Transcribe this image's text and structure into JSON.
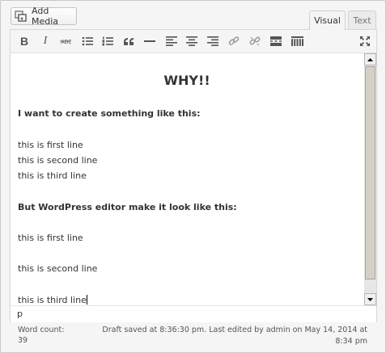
{
  "media": {
    "add_media_label": "Add Media"
  },
  "tabs": {
    "visual": "Visual",
    "text": "Text"
  },
  "toolbar": {
    "icons": [
      "bold-icon",
      "italic-icon",
      "strikethrough-icon",
      "bulleted-list-icon",
      "numbered-list-icon",
      "blockquote-icon",
      "horizontal-line-icon",
      "align-left-icon",
      "align-center-icon",
      "align-right-icon",
      "insert-link-icon",
      "remove-link-icon",
      "read-more-icon",
      "toolbar-toggle-icon",
      "fullscreen-icon"
    ]
  },
  "content": {
    "heading": "WHY!!",
    "intro": "I want to create something like this:",
    "first_block": [
      "this is first line",
      "this is second line",
      "this is third line"
    ],
    "second_intro": "But WordPress editor make it look like this:",
    "second_block": [
      "this is first line",
      "this is second line",
      "this is third line"
    ]
  },
  "path": {
    "element": "p"
  },
  "status": {
    "word_count_label": "Word count:",
    "word_count_value": "39",
    "draft_line1": "Draft saved at 8:36:30 pm. Last edited by admin on May 14, 2014 at",
    "draft_line2": "8:34 pm"
  }
}
